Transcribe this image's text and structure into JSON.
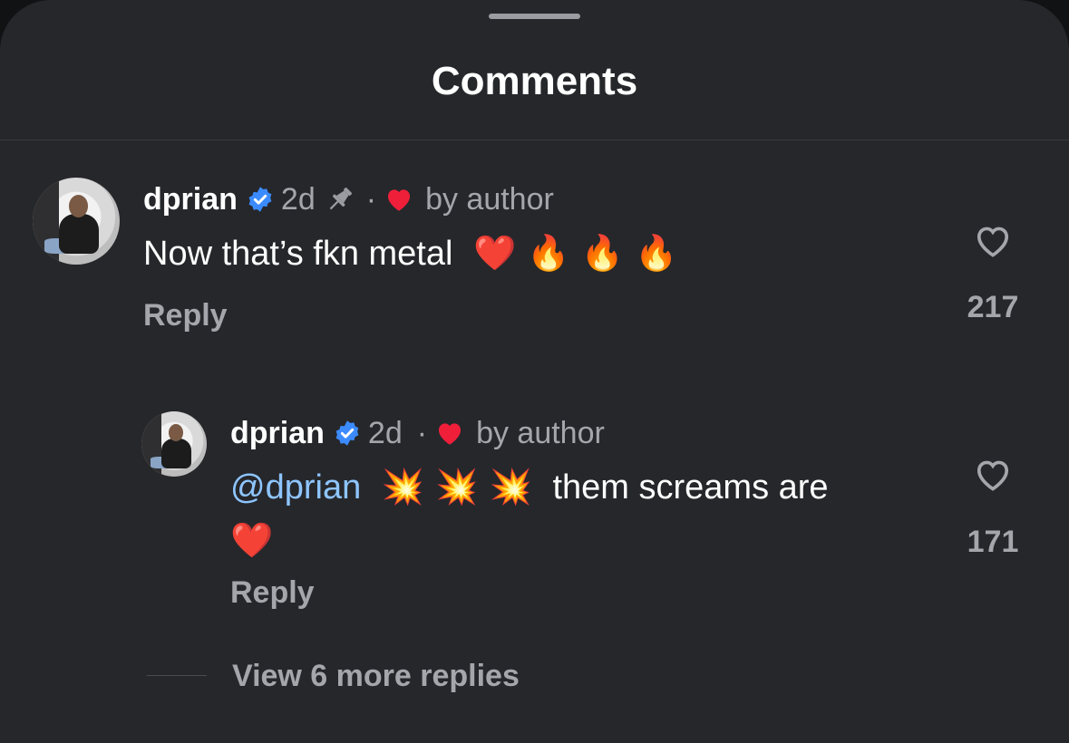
{
  "header": {
    "title": "Comments"
  },
  "comments": [
    {
      "username": "dprian",
      "time": "2d",
      "dot": "·",
      "liked_by": "by author",
      "text": "Now that’s fkn metal",
      "emojis": "❤️ 🔥 🔥 🔥",
      "reply_label": "Reply",
      "likes": "217",
      "pinned": true
    },
    {
      "username": "dprian",
      "time": "2d",
      "dot": "·",
      "liked_by": "by author",
      "mention": "@dprian",
      "emojis": "💥 💥 💥",
      "text": "them screams are",
      "trailing_emoji": "❤️",
      "reply_label": "Reply",
      "likes": "171",
      "pinned": false
    }
  ],
  "view_more": "View 6 more replies",
  "colors": {
    "background": "#26272b",
    "mention": "#8ec5ff",
    "heart": "#ef1f3a",
    "verified": "#3b8bff"
  },
  "icons": [
    "verified-badge-icon",
    "pin-icon",
    "heart-filled-icon",
    "heart-outline-icon"
  ]
}
